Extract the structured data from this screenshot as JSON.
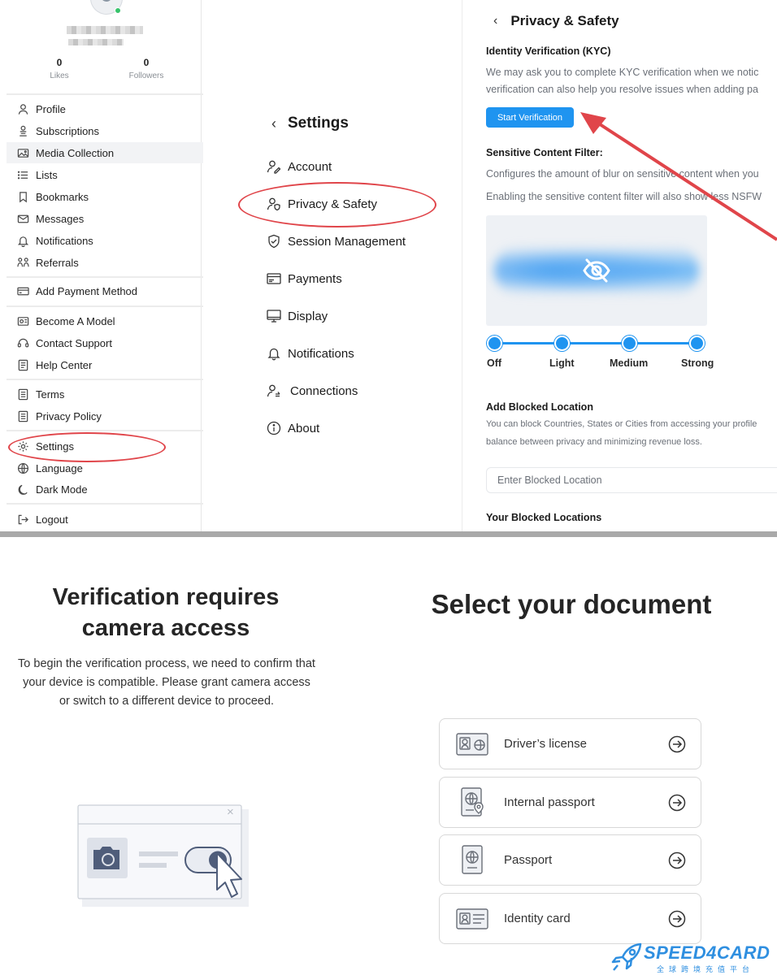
{
  "profile": {
    "stats": [
      {
        "value": "0",
        "label": "Likes"
      },
      {
        "value": "0",
        "label": "Followers"
      }
    ]
  },
  "sidebar": {
    "items": [
      {
        "label": "Profile",
        "icon": "user-icon"
      },
      {
        "label": "Subscriptions",
        "icon": "subscriptions-icon"
      },
      {
        "label": "Media Collection",
        "icon": "image-icon"
      },
      {
        "label": "Lists",
        "icon": "list-icon"
      },
      {
        "label": "Bookmarks",
        "icon": "bookmark-icon"
      },
      {
        "label": "Messages",
        "icon": "mail-icon"
      },
      {
        "label": "Notifications",
        "icon": "bell-icon"
      },
      {
        "label": "Referrals",
        "icon": "referrals-icon"
      },
      {
        "label": "Add Payment Method",
        "icon": "card-icon"
      },
      {
        "label": "Become A Model",
        "icon": "model-icon"
      },
      {
        "label": "Contact Support",
        "icon": "support-icon"
      },
      {
        "label": "Help Center",
        "icon": "book-icon"
      },
      {
        "label": "Terms",
        "icon": "document-icon"
      },
      {
        "label": "Privacy Policy",
        "icon": "document-icon"
      },
      {
        "label": "Settings",
        "icon": "gear-icon"
      },
      {
        "label": "Language",
        "icon": "globe-icon"
      },
      {
        "label": "Dark Mode",
        "icon": "moon-icon"
      },
      {
        "label": "Logout",
        "icon": "logout-icon"
      }
    ]
  },
  "settings": {
    "title": "Settings",
    "back": "‹",
    "items": [
      {
        "label": "Account",
        "icon": "account-edit-icon"
      },
      {
        "label": "Privacy & Safety",
        "icon": "privacy-shield-user-icon"
      },
      {
        "label": "Session Management",
        "icon": "shield-check-icon"
      },
      {
        "label": "Payments",
        "icon": "payments-icon"
      },
      {
        "label": "Display",
        "icon": "monitor-icon"
      },
      {
        "label": "Notifications",
        "icon": "bell-icon"
      },
      {
        "label": "Connections",
        "icon": "connections-icon"
      },
      {
        "label": "About",
        "icon": "info-icon"
      }
    ]
  },
  "privacy": {
    "title": "Privacy & Safety",
    "back": "‹",
    "kyc_heading": "Identity Verification (KYC)",
    "kyc_text_1": "We may ask you to complete KYC verification when we notic",
    "kyc_text_2": "verification can also help you resolve issues when adding pa",
    "kyc_button": "Start Verification",
    "filter_heading": "Sensitive Content Filter:",
    "filter_text_1": "Configures the amount of blur on sensitive content when you",
    "filter_text_2": "Enabling the sensitive content filter will also show less NSFW",
    "filter_levels": [
      "Off",
      "Light",
      "Medium",
      "Strong"
    ],
    "filter_selected": "Strong",
    "blocked_heading": "Add Blocked Location",
    "blocked_text_1": "You can block Countries, States or Cities from accessing your profile",
    "blocked_text_2": "balance between privacy and minimizing revenue loss.",
    "blocked_placeholder": "Enter Blocked Location",
    "your_blocked_heading": "Your Blocked Locations"
  },
  "camera": {
    "heading": "Verification requires camera access",
    "body": "To begin the verification process, we need to confirm that your device is compatible. Please grant camera access or switch to a different device to proceed.",
    "close_glyph": "×"
  },
  "documents": {
    "heading": "Select your document",
    "items": [
      {
        "label": "Driver’s license",
        "icon": "drivers-license-icon"
      },
      {
        "label": "Internal passport",
        "icon": "internal-passport-icon"
      },
      {
        "label": "Passport",
        "icon": "passport-icon"
      },
      {
        "label": "Identity card",
        "icon": "identity-card-icon"
      }
    ]
  },
  "brand": {
    "name": "SPEED4CARD",
    "tagline": "全球跨境充值平台"
  },
  "colors": {
    "accent": "#1f94f0",
    "annotation": "#e0454a",
    "online": "#37c36b"
  }
}
